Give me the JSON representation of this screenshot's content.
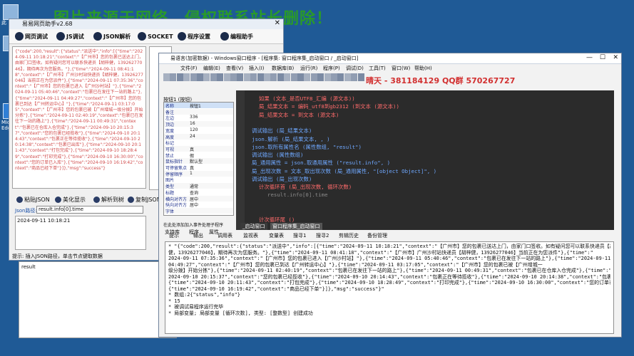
{
  "watermark": "图片来源于网络，侵权联系站长删除！",
  "desktop": {
    "labels": [
      "此",
      "Mic\nEdg"
    ]
  },
  "helper": {
    "title": "易易网页助手v2.68",
    "toolbar": [
      "网页调试",
      "JS调试",
      "JSON解析",
      "SOCKET",
      "程序设置",
      "编程助手"
    ],
    "json_text": "{\"code\":200,\"result\":{\"status\":\"派送中\",\"info\":[{\"time\":\"2024-09-11 10:18:21\",\"context\":\"【广州市】您的包裹已送达上门，由家门口签收。如有疑问您可以联系快递员【胡梓健，13926277046】，期待再次为您服务。\"},{\"time\":\"2024-09-11 08:41:18\",\"context\":\"【广州市】广州沙村站快递员【胡梓健，13926277046】当前正在为您派件\"},{\"time\":\"2024-09-11 07:35:36\",\"context\":\"【广州市】您的包裹已进入【广州沙村站】\"},{\"time\":\"2024-09-11 05:40:46\",\"context\":\"包裹已在发往下一站的路上\"},{\"time\":\"2024-09-11 04:49:27\",\"context\":\"【广州市】您的包裹已到达【广州转运中心】\"},{\"time\":\"2024-09-11 03:17:05\",\"context\":\"【广州市】您的包裹已被【广州增城一级分拨】开始分拣\"},{\"time\":\"2024-09-11 02:40:19\",\"context\":\"包裹已在发往下一站的路上\"},{\"time\":\"2024-09-11 00:49:31\",\"context\":\"包裹已在仓库入仓完成\"},{\"time\":\"2024-09-10 20:15:37\",\"context\":\"您的包裹已经揽收\"},{\"time\":\"2024-09-10 20:14:43\",\"context\":\"包裹正在等待揽收\"},{\"time\":\"2024-09-10 20:14:38\",\"context\":\"包裹已出库\"},{\"time\":\"2024-09-10 20:11:43\",\"context\":\"打包完成\"},{\"time\":\"2024-09-10 18:28:49\",\"context\":\"打印完成\"},{\"time\":\"2024-09-10 16:30:00\",\"context\":\"您的订单已入库\"},{\"time\":\"2024-09-10 16:19:42\",\"context\":\"商品已经下单\"}]},\"msg\":\"success\"}",
    "buttons": [
      "粘贴JSON",
      "美化显示",
      "解析到树",
      "复制JSON"
    ],
    "path_label": "Json路径:",
    "path_value": "result.info[0].time",
    "result_value": "2024-09-11 10:18:21",
    "status": "提示: 插入JSON路径，单击节点键取数据",
    "bottom_label": "result"
  },
  "ide": {
    "title": "易语言(加密数据) - Windows窗口程序 - [程序集: 窗口程序集_启动窗口 / _启动窗口]",
    "menu": [
      "文件(F)",
      "编辑(E)",
      "查看(V)",
      "插入(I)",
      "数据库(B)",
      "运行(R)",
      "程序(P)",
      "调试(D)",
      "工具(T)",
      "窗口(W)",
      "帮助(H)",
      "设置"
    ],
    "banner": "晴天 - 381184129  QQ群 570267727",
    "props_header": "按钮1 (按钮)",
    "props": [
      [
        "名称",
        "按钮1"
      ],
      [
        "备注",
        ""
      ],
      [
        "左边",
        "336"
      ],
      [
        "顶边",
        "16"
      ],
      [
        "宽度",
        "120"
      ],
      [
        "高度",
        "24"
      ],
      [
        "标记",
        ""
      ],
      [
        "可视",
        "真"
      ],
      [
        "禁止",
        "假"
      ],
      [
        "鼠标指针",
        "默认型"
      ],
      [
        "可停留焦点",
        "真"
      ],
      [
        "停留顺序",
        "1"
      ],
      [
        "图片",
        ""
      ],
      [
        "类型",
        "通常"
      ],
      [
        "标题",
        "查询"
      ],
      [
        "横向对齐方式",
        "居中"
      ],
      [
        "纵向对齐方式",
        "居中"
      ],
      [
        "字体",
        ""
      ]
    ],
    "hint": "在此处添加加入事件处理子程序",
    "left_tabs": [
      "支持库",
      "程序",
      "属性"
    ],
    "editor_tabs": [
      "_启动窗口",
      "窗口程序集_启动窗口"
    ],
    "code_lines": [
      {
        "t": "如果 (文本_是否UTF8_汇编 (源文本))",
        "c": "#ff6b6b",
        "x": 32
      },
      {
        "t": "局_结果文本 = 编码_utf8到gb2312 (到文本 (源文本))",
        "c": "#ff6b6b",
        "x": 32
      },
      {
        "t": "局_结果文本 = 到文本 (源文本)",
        "c": "#ff6b6b",
        "x": 32
      },
      {
        "t": "",
        "c": "#ff6b6b",
        "x": 32
      },
      {
        "t": "调试输出 (局_结果文本)",
        "c": "#6fa8ff",
        "x": 22
      },
      {
        "t": "json.解析 (局_结果文本, , )",
        "c": "#6fa8ff",
        "x": 22
      },
      {
        "t": "json.取所有属性名 (属性数组, \"result\")",
        "c": "#6fa8ff",
        "x": 22
      },
      {
        "t": "调试输出 (属性数组)",
        "c": "#6fa8ff",
        "x": 22
      },
      {
        "t": "局_通用属性 = json.取通用属性 (\"result.info\", )",
        "c": "#6fa8ff",
        "x": 22
      },
      {
        "t": "局_出现次数 = 文本_取出现次数 (局_通用属性, \"[object Object]\", )",
        "c": "#6fa8ff",
        "x": 22
      },
      {
        "t": "调试输出 (局_出现次数)",
        "c": "#6fa8ff",
        "x": 22
      },
      {
        "t": "计次循环首 (局_出现次数, 循环次数)",
        "c": "#ff6b6b",
        "x": 32
      },
      {
        "t": "result.info[0].time",
        "c": "#8a8a8a",
        "x": 44
      },
      {
        "t": "",
        "c": "#ff6b6b",
        "x": 32
      },
      {
        "t": "",
        "c": "#ff6b6b",
        "x": 32
      },
      {
        "t": "计次循环尾 ()",
        "c": "#ff6b6b",
        "x": 32
      }
    ],
    "bottom_tabs": [
      "提示",
      "输出",
      "调用表",
      "监视表",
      "变量表",
      "搜寻1",
      "搜寻2",
      "剪辑历史",
      "备份管理"
    ],
    "output_lines": [
      "* \"{\"code\":200,\"result\":{\"status\":\"派送中\",\"info\":[{\"time\":\"2024-09-11 10:18:21\",\"context\":\"【广州市】您的包裹已送达上门，由家门口签收。如有疑问您可以联系快递员【胡梓",
      "健，13926277046】，期待再次为您服务。\"},{\"time\":\"2024-09-11 08:41:18\",\"context\":\"【广州市】广州沙村站快递员【胡梓健，13926277046】当前正在为您派件\"},{\"time\":\"",
      "2024-09-11 07:35:36\",\"context\":\"【广州市】您的包裹已进入【广州沙村站】\"},{\"time\":\"2024-09-11 05:40:46\",\"context\":\"包裹已在发往下一站的路上\"},{\"time\":\"2024-09-11",
      "04:49:27\",\"context\":\"【广州市】您的包裹已到达【广州转运中心】\"},{\"time\":\"2024-09-11 03:17:05\",\"context\":\"【广州市】您的包裹已被【广州增城一",
      "级分拨】开始分拣\"},{\"time\":\"2024-09-11 02:40:19\",\"context\":\"包裹已在发往下一站的路上\"},{\"time\":\"2024-09-11 00:49:31\",\"context\":\"包裹已在仓库入仓完成\"},{\"time\":\"",
      "2024-09-10 20:15:37\",\"context\":\"您的包裹已经揽收\"},{\"time\":\"2024-09-10 20:14:43\",\"context\":\"包裹正在等待揽收\"},{\"time\":\"2024-09-10 20:14:38\",\"context\":\"包裹已出库\"},",
      "{\"time\":\"2024-09-10 20:11:43\",\"context\":\"打包完成\"},{\"time\":\"2024-09-10 18:28:49\",\"context\":\"打印完成\"},{\"time\":\"2024-09-10 16:30:00\",\"context\":\"您的订单已入库\"},",
      "{\"time\":\"2024-09-10 16:19:42\",\"context\":\"商品已经下单\"}]},\"msg\":\"success\"}\"",
      "* 数组:2{\"status\",\"info\"}",
      "* 15",
      "* 被调试易程序运行完毕",
      "* 局部变量; 局部变量 [循环次数], 类型: [整数型] 创建成功"
    ]
  }
}
